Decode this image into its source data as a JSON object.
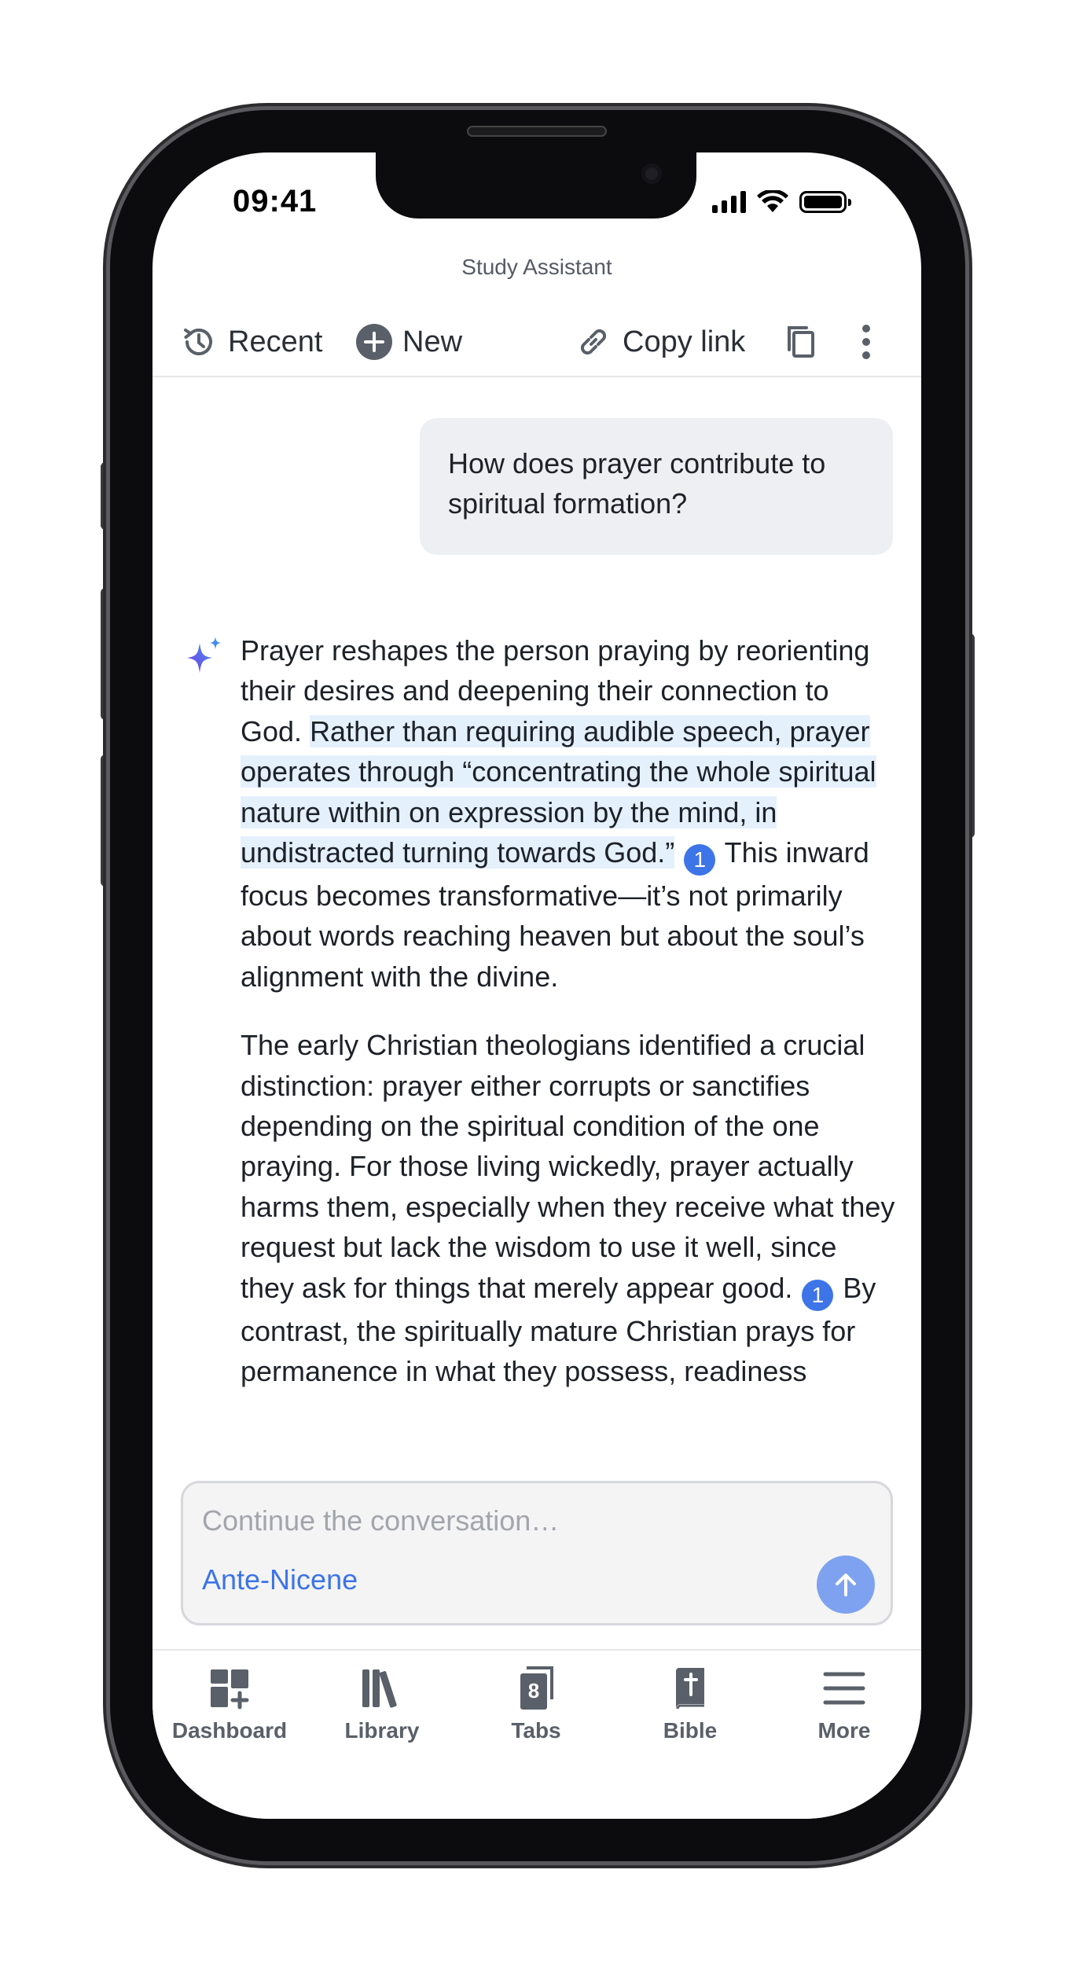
{
  "status": {
    "time": "09:41"
  },
  "header": {
    "title": "Study Assistant"
  },
  "toolbar": {
    "recent_label": "Recent",
    "new_label": "New",
    "copy_link_label": "Copy link"
  },
  "conversation": {
    "user_message": "How does prayer contribute to spiritual formation?",
    "answer": {
      "p1_a": "Prayer reshapes the person praying by reorienting their desires and deepening their connection to God. ",
      "p1_quote": "Rather than requiring audible speech, prayer operates through “concentrating the whole spiritual nature within on expression by the mind, in undistracted turning towards God.”",
      "p1_cite": "1",
      "p1_b": " This inward focus becomes transformative—it’s not primarily about words reaching heaven but about the soul’s alignment with the divine.",
      "p2_a": "The early Christian theologians identified a crucial distinction: prayer either corrupts or sanctifies depending on the spiritual condition of the one praying. For those living wickedly, prayer actually harms them, especially when they receive what they request but lack the wisdom to use it well, since they ask for things that merely appear good.",
      "p2_cite": "1",
      "p2_b": " By contrast, the spiritually mature Christian prays for permanence in what they possess, readiness"
    }
  },
  "composer": {
    "placeholder": "Continue the conversation…",
    "collection": "Ante-Nicene"
  },
  "tabbar": {
    "items": [
      {
        "label": "Dashboard"
      },
      {
        "label": "Library"
      },
      {
        "label": "Tabs",
        "badge": "8"
      },
      {
        "label": "Bible"
      },
      {
        "label": "More"
      }
    ]
  },
  "colors": {
    "accent": "#3d74e8",
    "quote_highlight": "#e4f0fc",
    "bubble": "#eeeff2"
  }
}
